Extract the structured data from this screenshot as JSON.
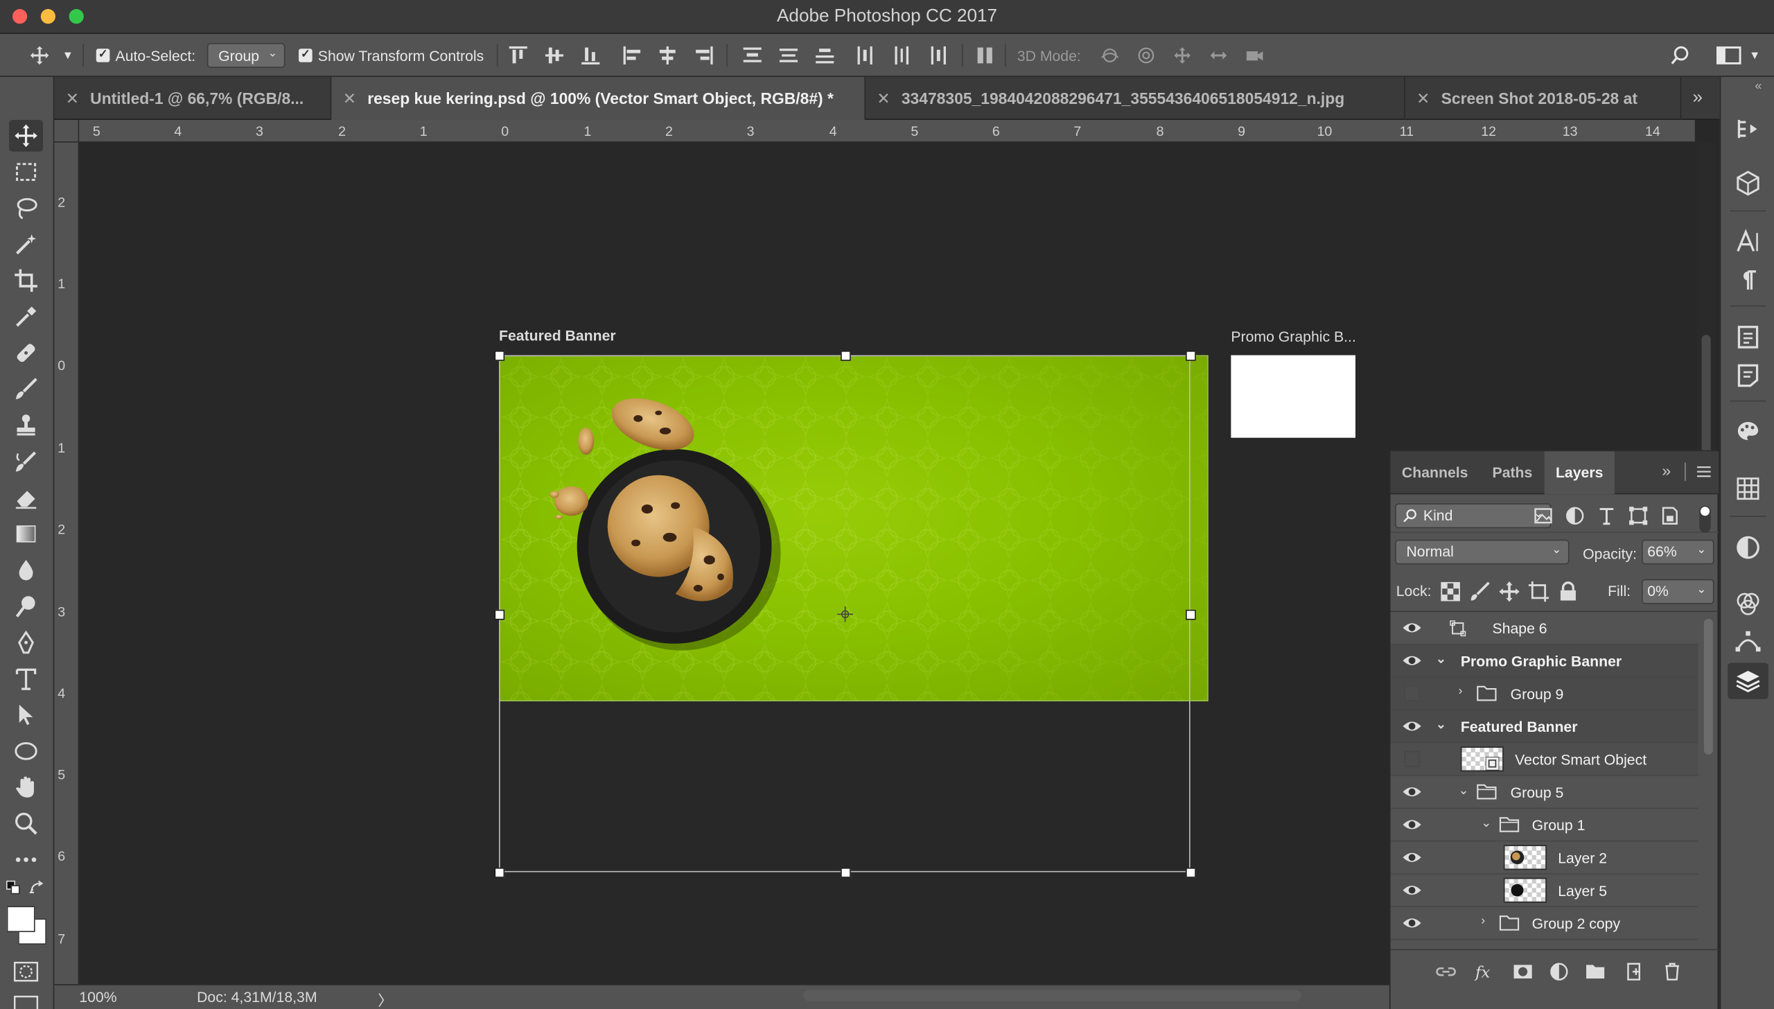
{
  "window": {
    "title": "Adobe Photoshop CC 2017"
  },
  "options": {
    "auto_select_label": "Auto-Select:",
    "auto_select_value": "Group",
    "show_transform_label": "Show Transform Controls",
    "mode3d_label": "3D Mode:"
  },
  "tabs": [
    {
      "label": "Untitled-1 @ 66,7% (RGB/8..."
    },
    {
      "label": "resep kue kering.psd @ 100% (Vector Smart Object, RGB/8#) *"
    },
    {
      "label": "33478305_1984042088296471_3555436406518054912_n.jpg"
    },
    {
      "label": "Screen Shot 2018-05-28 at"
    }
  ],
  "rulers": {
    "h": [
      "5",
      "4",
      "3",
      "2",
      "1",
      "0",
      "1",
      "2",
      "3",
      "4",
      "5",
      "6",
      "7",
      "8",
      "9",
      "10",
      "11",
      "12",
      "13",
      "14"
    ],
    "v": [
      "2",
      "1",
      "0",
      "1",
      "2",
      "3",
      "4",
      "5",
      "6",
      "7"
    ]
  },
  "artboards": {
    "featured_label": "Featured Banner",
    "promo_label": "Promo Graphic B..."
  },
  "status": {
    "zoom": "100%",
    "doc": "Doc: 4,31M/18,3M",
    "arrow": "〉"
  },
  "layers_panel": {
    "tabs": [
      "Channels",
      "Paths",
      "Layers"
    ],
    "kind_label": "Kind",
    "blend_mode": "Normal",
    "opacity_label": "Opacity:",
    "opacity_value": "66%",
    "lock_label": "Lock:",
    "fill_label": "Fill:",
    "fill_value": "0%",
    "layers": [
      {
        "name": "Shape 6",
        "visible": true
      },
      {
        "name": "Promo Graphic Banner",
        "visible": true
      },
      {
        "name": "Group 9",
        "visible": false
      },
      {
        "name": "Featured Banner",
        "visible": true
      },
      {
        "name": "Vector Smart Object",
        "visible": false
      },
      {
        "name": "Group 5",
        "visible": true
      },
      {
        "name": "Group 1",
        "visible": true
      },
      {
        "name": "Layer 2",
        "visible": true
      },
      {
        "name": "Layer 5",
        "visible": true
      },
      {
        "name": "Group 2 copy",
        "visible": true
      }
    ]
  },
  "colors": {
    "banner_green": "#88c000",
    "ui_gray": "#535353",
    "canvas": "#282828"
  }
}
